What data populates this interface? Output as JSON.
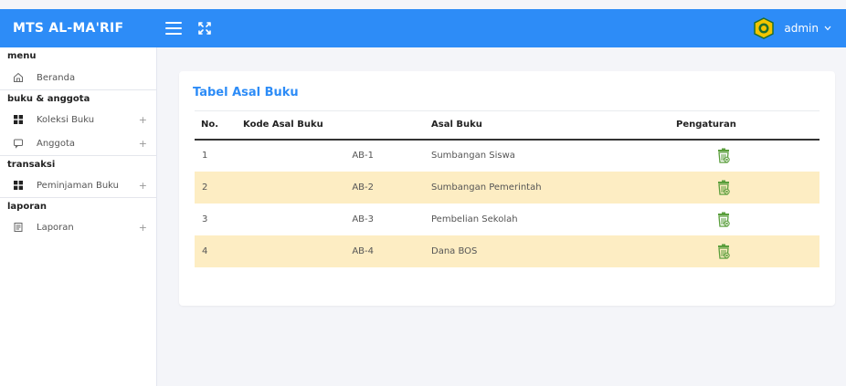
{
  "app": {
    "brand": "MTS AL-MA'RIF"
  },
  "header": {
    "user_name": "admin",
    "accent": "#2d8cf7"
  },
  "sidebar": {
    "sections": [
      {
        "title": "menu",
        "items": [
          {
            "label": "Beranda",
            "icon": "home-icon",
            "expandable": false
          }
        ]
      },
      {
        "title": "buku & anggota",
        "items": [
          {
            "label": "Koleksi Buku",
            "icon": "grid-icon",
            "expandable": true,
            "expander": "+"
          },
          {
            "label": "Anggota",
            "icon": "chat-icon",
            "expandable": true,
            "expander": "+"
          }
        ]
      },
      {
        "title": "transaksi",
        "items": [
          {
            "label": "Peminjaman Buku",
            "icon": "grid-icon",
            "expandable": true,
            "expander": "+"
          }
        ]
      },
      {
        "title": "laporan",
        "items": [
          {
            "label": "Laporan",
            "icon": "report-icon",
            "expandable": true,
            "expander": "+"
          }
        ]
      }
    ]
  },
  "main": {
    "title": "Tabel Asal Buku",
    "table": {
      "headers": [
        "No.",
        "Kode Asal Buku",
        "Asal Buku",
        "Pengaturan"
      ],
      "rows": [
        {
          "no": "1",
          "kode": "AB-1",
          "asal": "Sumbangan Siswa"
        },
        {
          "no": "2",
          "kode": "AB-2",
          "asal": "Sumbangan Pemerintah"
        },
        {
          "no": "3",
          "kode": "AB-3",
          "asal": "Pembelian Sekolah"
        },
        {
          "no": "4",
          "kode": "AB-4",
          "asal": "Dana BOS"
        }
      ],
      "stripe_color": "#fdedc3",
      "action_icon": "trash-delete-icon",
      "action_color": "#5a9e3c"
    }
  }
}
